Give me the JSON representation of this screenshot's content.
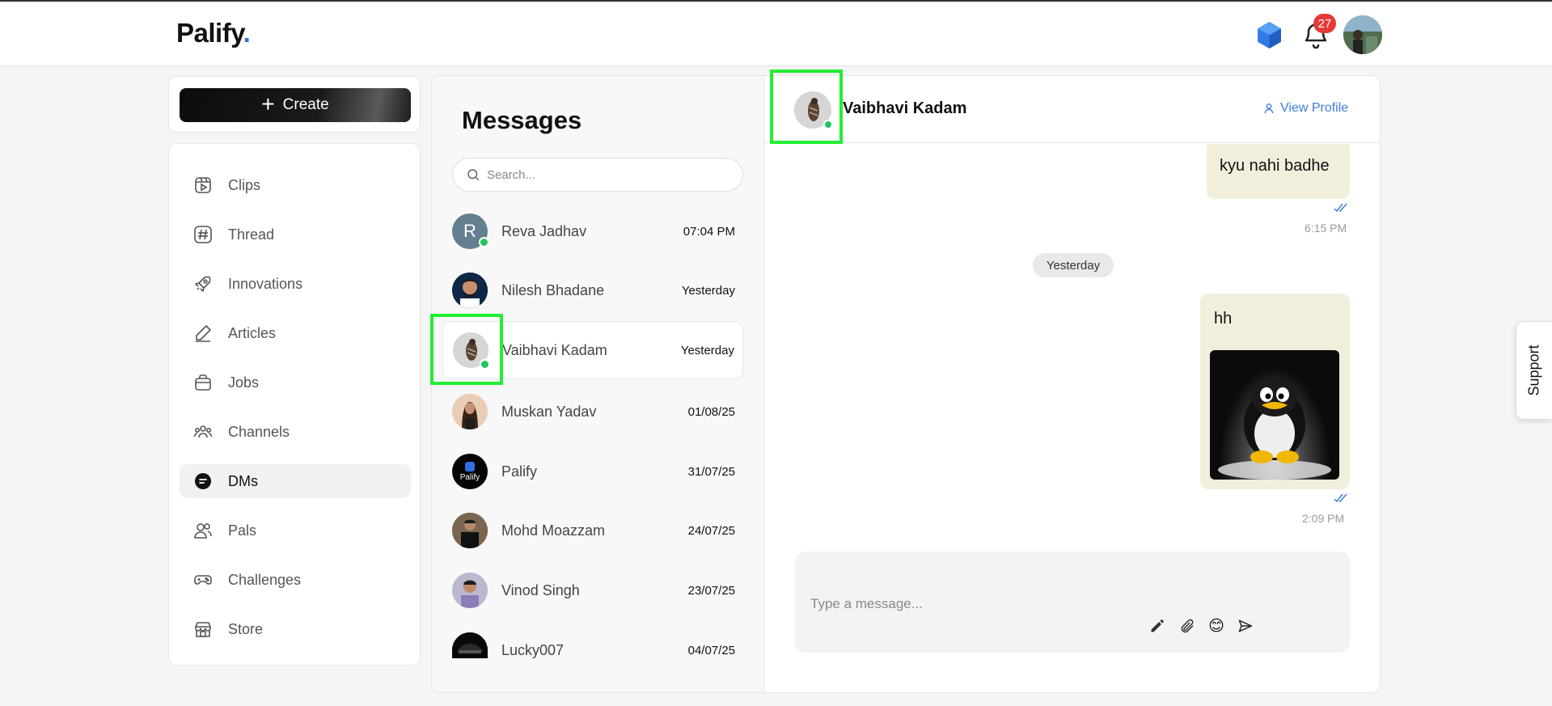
{
  "header": {
    "logo": "Palify",
    "logo_dot": ".",
    "notification_count": "27"
  },
  "sidebar": {
    "create_label": "Create",
    "items": [
      {
        "label": "Clips",
        "icon": "clips-icon"
      },
      {
        "label": "Thread",
        "icon": "hashtag-icon"
      },
      {
        "label": "Innovations",
        "icon": "rocket-icon"
      },
      {
        "label": "Articles",
        "icon": "pen-icon"
      },
      {
        "label": "Jobs",
        "icon": "briefcase-icon"
      },
      {
        "label": "Channels",
        "icon": "people-group-icon"
      },
      {
        "label": "DMs",
        "icon": "chat-bubble-icon",
        "active": true
      },
      {
        "label": "Pals",
        "icon": "users-icon"
      },
      {
        "label": "Challenges",
        "icon": "gamepad-icon"
      },
      {
        "label": "Store",
        "icon": "storefront-icon"
      }
    ]
  },
  "messages": {
    "title": "Messages",
    "search_placeholder": "Search...",
    "contacts": [
      {
        "name": "Reva Jadhav",
        "time": "07:04 PM",
        "online": true,
        "initial": "R"
      },
      {
        "name": "Nilesh Bhadane",
        "time": "Yesterday",
        "online": false
      },
      {
        "name": "Vaibhavi Kadam",
        "time": "Yesterday",
        "online": true,
        "active": true
      },
      {
        "name": "Muskan Yadav",
        "time": "01/08/25",
        "online": false
      },
      {
        "name": "Palify",
        "time": "31/07/25",
        "online": false,
        "logo_text": "Palify"
      },
      {
        "name": "Mohd Moazzam",
        "time": "24/07/25",
        "online": false
      },
      {
        "name": "Vinod Singh",
        "time": "23/07/25",
        "online": false
      },
      {
        "name": "Lucky007",
        "time": "04/07/25",
        "online": false
      }
    ]
  },
  "chat": {
    "name": "Vaibhavi Kadam",
    "view_profile": "View Profile",
    "messages": [
      {
        "text": "kyu nahi badhe",
        "time": "6:15 PM"
      },
      {
        "text": "hh",
        "time": "2:09 PM",
        "has_image": true
      }
    ],
    "day_separator": "Yesterday",
    "composer_placeholder": "Type a message...",
    "emoji": "😊"
  },
  "support_label": "Support",
  "colors": {
    "accent_blue": "#3b7bd9",
    "online_green": "#22c55e",
    "badge_red": "#e53935",
    "bubble_bg": "#f1efdc",
    "highlight_green": "#22ee33"
  }
}
